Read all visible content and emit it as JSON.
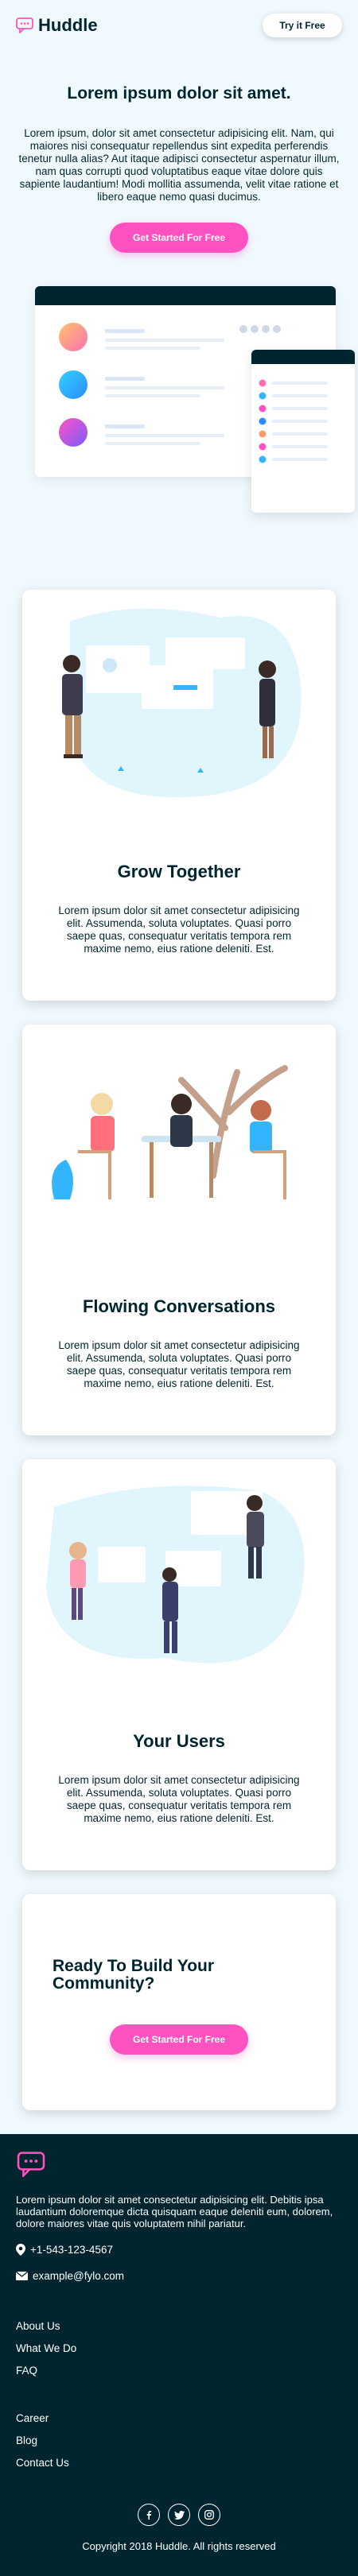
{
  "header": {
    "brand": "Huddle",
    "try_label": "Try it Free"
  },
  "hero": {
    "title": "Lorem ipsum dolor sit amet.",
    "body": "Lorem ipsum, dolor sit amet consectetur adipisicing elit. Nam, qui maiores nisi consequatur repellendus sint expedita perferendis tenetur nulla alias? Aut itaque adipisci consectetur aspernatur illum, nam quas corrupti quod voluptatibus eaque vitae dolore quis sapiente laudantium! Modi mollitia assumenda, velit vitae ratione et libero eaque nemo quasi ducimus.",
    "cta_label": "Get Started For Free"
  },
  "features": [
    {
      "title": "Grow Together",
      "body": "Lorem ipsum dolor sit amet consectetur adipisicing elit. Assumenda, soluta voluptates. Quasi porro saepe quas, consequatur veritatis tempora rem maxime nemo, eius ratione deleniti. Est."
    },
    {
      "title": "Flowing Conversations",
      "body": "Lorem ipsum dolor sit amet consectetur adipisicing elit. Assumenda, soluta voluptates. Quasi porro saepe quas, consequatur veritatis tempora rem maxime nemo, eius ratione deleniti. Est."
    },
    {
      "title": "Your Users",
      "body": "Lorem ipsum dolor sit amet consectetur adipisicing elit. Assumenda, soluta voluptates. Quasi porro saepe quas, consequatur veritatis tempora rem maxime nemo, eius ratione deleniti. Est."
    }
  ],
  "ready": {
    "title": "Ready To Build Your Community?",
    "cta_label": "Get Started For Free"
  },
  "footer": {
    "intro": "Lorem ipsum dolor sit amet consectetur adipisicing elit. Debitis ipsa laudantium doloremque dicta quisquam eaque deleniti eum, dolorem, dolore maiores vitae quis voluptatem nihil pariatur.",
    "phone": "+1-543-123-4567",
    "email": "example@fylo.com",
    "links_1": [
      "About Us",
      "What We Do",
      "FAQ"
    ],
    "links_2": [
      "Career",
      "Blog",
      "Contact Us"
    ],
    "social_icons": [
      "facebook-icon",
      "twitter-icon",
      "instagram-icon"
    ],
    "copyright": "Copyright 2018 Huddle. All rights reserved"
  },
  "colors": {
    "accent": "#ff52c1",
    "dark": "#00252e",
    "bg": "#f0fafe"
  }
}
